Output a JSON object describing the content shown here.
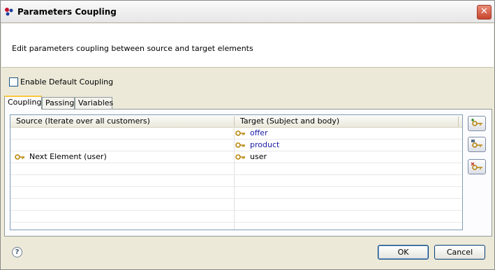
{
  "window": {
    "title": "Parameters Coupling"
  },
  "header": {
    "message": "Edit parameters coupling between source and target elements"
  },
  "options": {
    "enable_default_coupling_label": "Enable Default Coupling",
    "enable_default_coupling_checked": false
  },
  "tabs": [
    {
      "label": "Coupling",
      "active": true
    },
    {
      "label": "Passing",
      "active": false
    },
    {
      "label": "Variables",
      "active": false
    }
  ],
  "table": {
    "columns": [
      "Source (Iterate over all customers)",
      "Target (Subject and body)"
    ],
    "rows": [
      {
        "source": "",
        "target": "offer"
      },
      {
        "source": "",
        "target": "product"
      },
      {
        "source": "Next Element (user)",
        "target": "user"
      }
    ]
  },
  "side_buttons": [
    "add-coupling-icon",
    "auto-coupling-icon",
    "remove-coupling-icon"
  ],
  "footer": {
    "help": "?",
    "ok_label": "OK",
    "cancel_label": "Cancel"
  }
}
